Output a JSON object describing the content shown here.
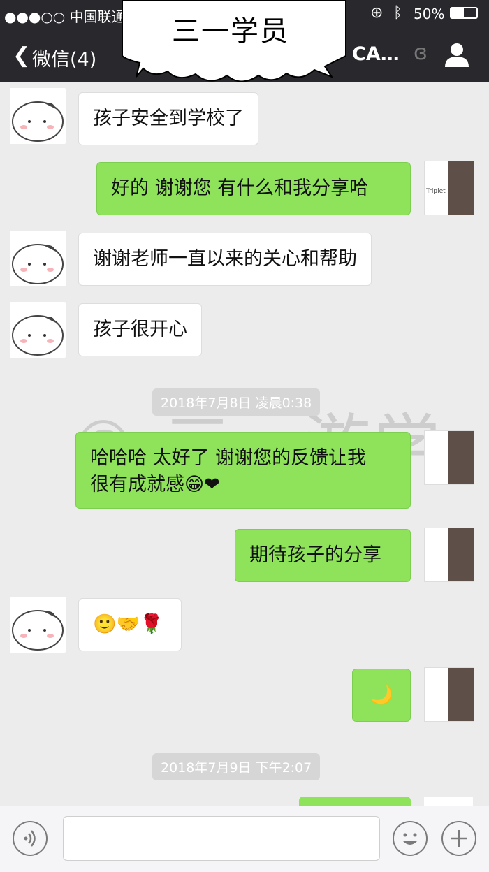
{
  "status": {
    "carrier": "●●●○○ 中国联通",
    "battery": "50%"
  },
  "nav": {
    "back_label": "微信(4)",
    "chat_name": "CA…"
  },
  "overlay_title": "三一学员",
  "watermark": "© 三一游学",
  "messages": [
    {
      "side": "left",
      "text": "孩子安全到学校了"
    },
    {
      "side": "right",
      "text": "好的 谢谢您 有什么和我分享哈"
    },
    {
      "side": "left",
      "text": "谢谢老师一直以来的关心和帮助"
    },
    {
      "side": "left",
      "text": "孩子很开心"
    },
    {
      "side": "right",
      "line1": "哈哈哈 太好了 谢谢您的反馈让我",
      "line2": "很有成就感😁❤"
    },
    {
      "side": "right",
      "text": "期待孩子的分享"
    },
    {
      "side": "left",
      "text": "🙂🤝🌹"
    },
    {
      "side": "right",
      "text": "🌙"
    }
  ],
  "timestamps": [
    "2018年7月8日 凌晨0:38",
    "2018年7月9日 下午2:07"
  ],
  "brand_label": "Triplet",
  "colors": {
    "header": "#28282d",
    "bubble_out": "#8ee35b",
    "bubble_in": "#ffffff",
    "bg": "#ececec"
  }
}
